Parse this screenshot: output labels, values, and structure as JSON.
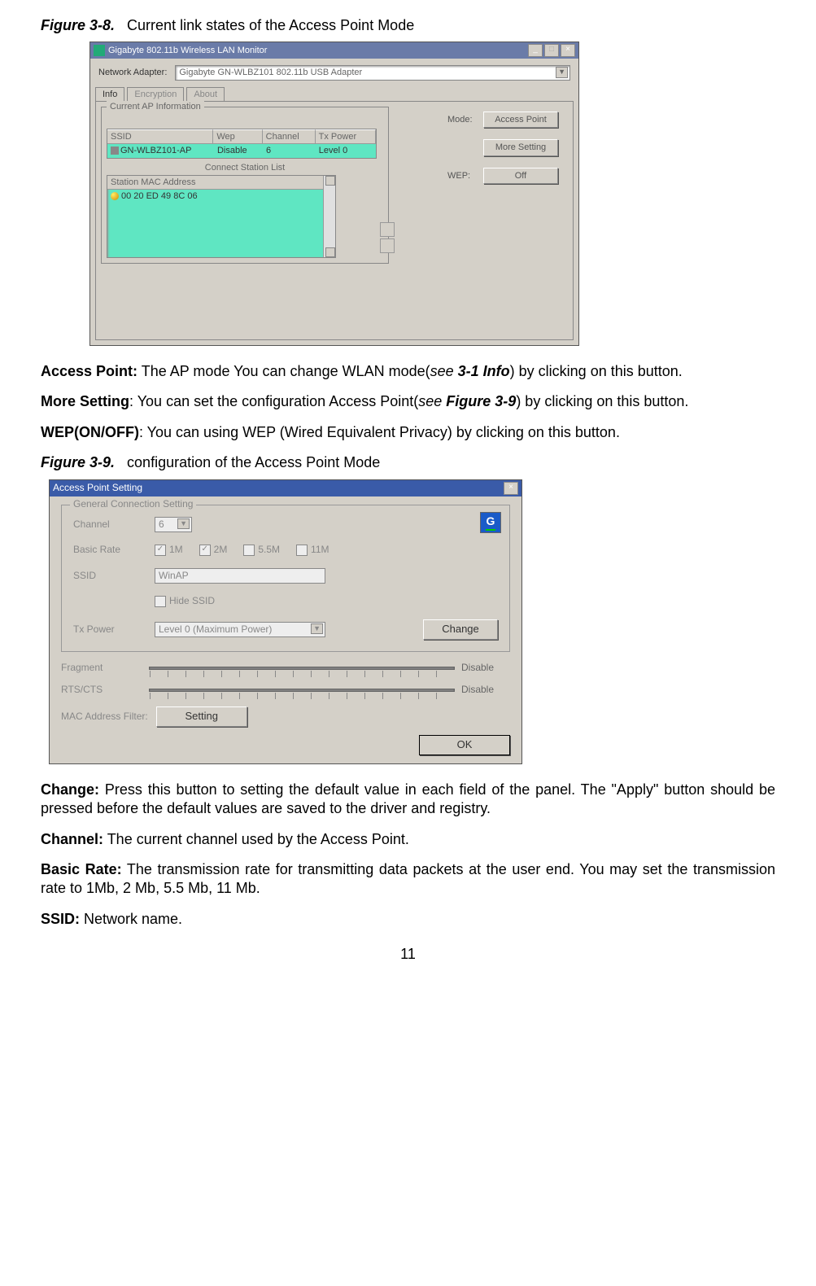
{
  "fig38": {
    "caption_label": "Figure 3-8.",
    "caption_text": "Current link states of the Access Point Mode",
    "title": "Gigabyte 802.11b Wireless LAN Monitor",
    "adapter_label": "Network Adapter:",
    "adapter_value": "Gigabyte GN-WLBZ101 802.11b USB Adapter",
    "tabs": {
      "info": "Info",
      "encryption": "Encryption",
      "about": "About"
    },
    "fieldset_legend": "Current AP Information",
    "table_headers": {
      "ssid": "SSID",
      "wep": "Wep",
      "channel": "Channel",
      "txpower": "Tx Power"
    },
    "table_row": {
      "ssid": "GN-WLBZ101-AP",
      "wep": "Disable",
      "channel": "6",
      "txpower": "Level 0"
    },
    "conn_label": "Connect Station List",
    "mac_header": "Station MAC Address",
    "mac_value": "00 20 ED 49 8C 06",
    "mode_label": "Mode:",
    "btn_access_point": "Access Point",
    "btn_more_setting": "More Setting",
    "wep_label": "WEP:",
    "btn_off": "Off"
  },
  "body1": {
    "access_point_lead": "Access Point:",
    "access_point_text": " The AP mode You can change WLAN mode(",
    "access_point_ref_pre": "see ",
    "access_point_ref": "3-1 Info",
    "access_point_tail": ") by clicking on this button.",
    "more_setting_lead": "More Setting",
    "more_setting_text": ": You can set the configuration Access Point(",
    "more_setting_ref_pre": "see ",
    "more_setting_ref": "Figure 3-9",
    "more_setting_tail": ") by clicking on this button.",
    "wep_lead": "WEP(ON/OFF)",
    "wep_text": ": You can using WEP (Wired Equivalent Privacy) by clicking on this button."
  },
  "fig39": {
    "caption_label": "Figure 3-9.",
    "caption_text": "configuration of the Access Point Mode",
    "title": "Access Point Setting",
    "group_legend": "General Connection Setting",
    "channel_label": "Channel",
    "channel_value": "6",
    "basic_rate_label": "Basic Rate",
    "rates": {
      "r1": "1M",
      "r2": "2M",
      "r3": "5.5M",
      "r4": "11M"
    },
    "ssid_label": "SSID",
    "ssid_value": "WinAP",
    "hide_ssid": "Hide SSID",
    "txpower_label": "Tx Power",
    "txpower_value": "Level 0 (Maximum Power)",
    "change_btn": "Change",
    "fragment_label": "Fragment",
    "rtscts_label": "RTS/CTS",
    "disable": "Disable",
    "mac_filter_label": "MAC Address Filter:",
    "setting_btn": "Setting",
    "ok_btn": "OK"
  },
  "body2": {
    "change_lead": "Change:",
    "change_text": " Press this button to setting the default value in each field of the panel. The \"Apply\" button should be pressed before the default values are saved to the driver and registry.",
    "channel_lead": "Channel:",
    "channel_text": " The current channel used by the Access Point.",
    "basic_rate_lead": "Basic Rate:",
    "basic_rate_text": " The transmission rate for transmitting data packets at the user end. You may set the transmission rate to 1Mb, 2 Mb, 5.5 Mb, 11 Mb.",
    "ssid_lead": "SSID:",
    "ssid_text": " Network name."
  },
  "page_number": "11"
}
